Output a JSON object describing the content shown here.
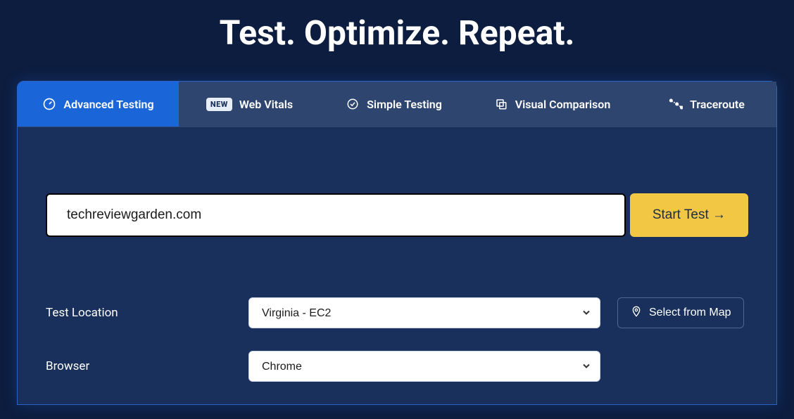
{
  "hero": {
    "title": "Test. Optimize. Repeat."
  },
  "tabs": [
    {
      "label": "Advanced Testing",
      "icon": "gauge-icon",
      "active": true
    },
    {
      "label": "Web Vitals",
      "icon": "",
      "badge": "NEW"
    },
    {
      "label": "Simple Testing",
      "icon": "check-circle-icon"
    },
    {
      "label": "Visual Comparison",
      "icon": "compare-icon"
    },
    {
      "label": "Traceroute",
      "icon": "traceroute-icon"
    }
  ],
  "form": {
    "url_value": "techreviewgarden.com",
    "start_label": "Start Test →",
    "location": {
      "label": "Test Location",
      "value": "Virginia - EC2",
      "map_button": "Select from Map"
    },
    "browser": {
      "label": "Browser",
      "value": "Chrome"
    }
  }
}
